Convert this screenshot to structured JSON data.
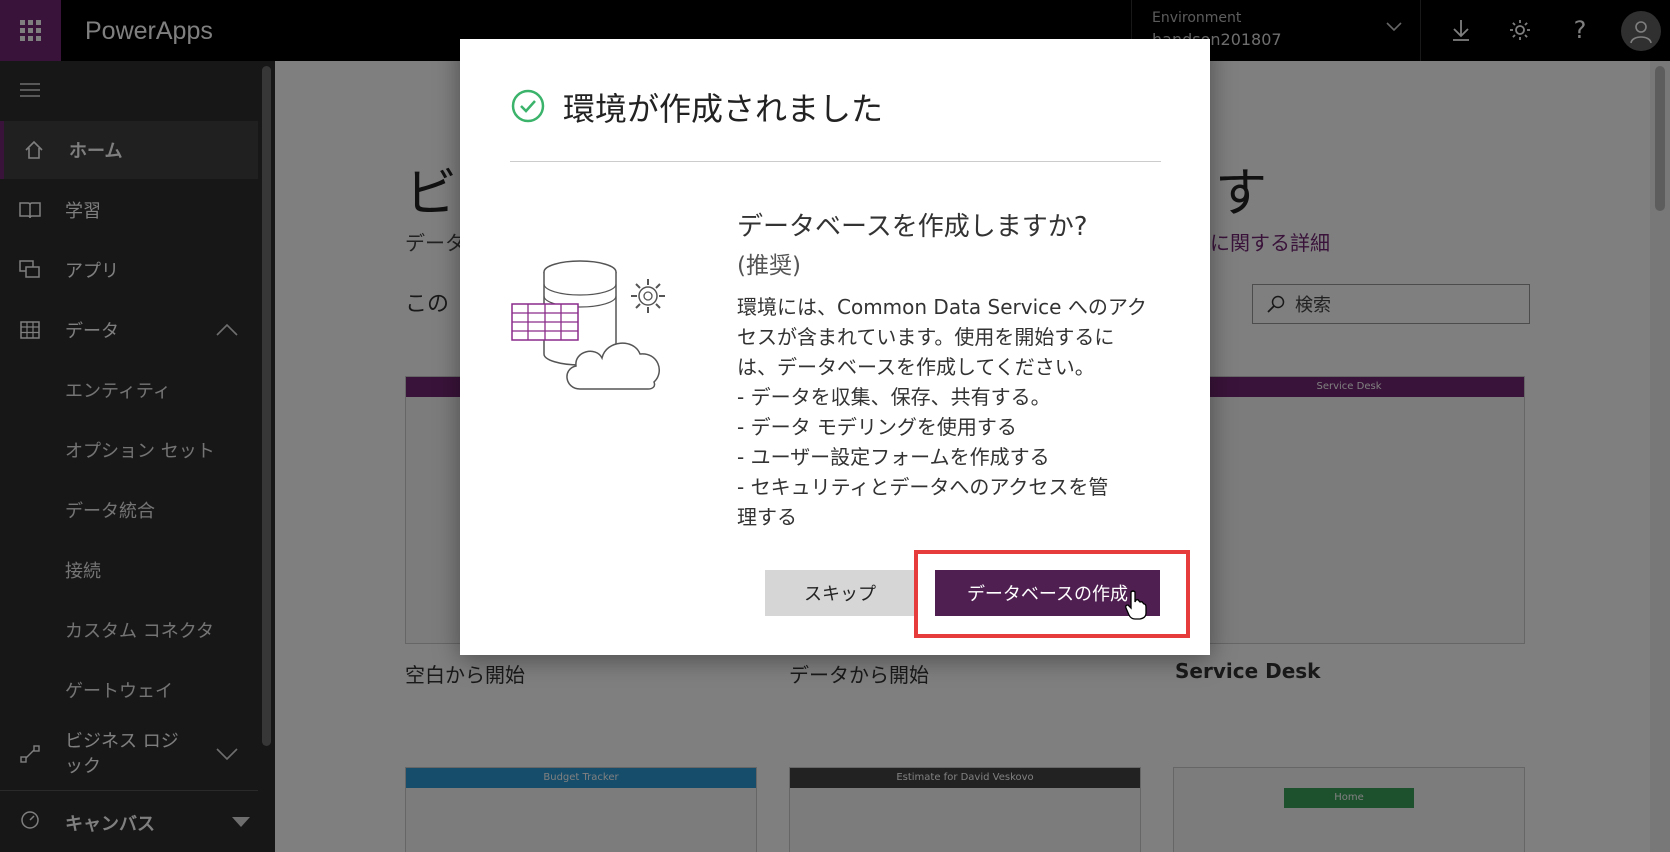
{
  "topbar": {
    "brand": "PowerApps",
    "environment_label": "Environment",
    "environment_name": "handson201807",
    "icons": [
      "waffle-icon",
      "download-icon",
      "gear-icon",
      "help-icon",
      "user-icon"
    ]
  },
  "sidebar": {
    "items": [
      {
        "label": "ホーム",
        "icon": "home-icon"
      },
      {
        "label": "学習",
        "icon": "book-icon"
      },
      {
        "label": "アプリ",
        "icon": "apps-icon"
      },
      {
        "label": "データ",
        "icon": "table-icon"
      },
      {
        "label": "エンティティ"
      },
      {
        "label": "オプション セット"
      },
      {
        "label": "データ統合"
      },
      {
        "label": "接続"
      },
      {
        "label": "カスタム コネクタ"
      },
      {
        "label": "ゲートウェイ"
      },
      {
        "label": "ビジネス ロジック",
        "line1": "ビジネス ロジ",
        "line2": "ック",
        "icon": "flow-icon"
      }
    ],
    "bottom": {
      "label": "キャンバス",
      "icon": "gauge-icon"
    }
  },
  "main": {
    "hero_title_start": "ビ",
    "hero_title_end": "す",
    "hero_sub": "データ",
    "hero_link": "に関する詳細",
    "section_title": "この",
    "search_placeholder": "検索",
    "cards": [
      {
        "label": "空白から開始"
      },
      {
        "label": "データから開始"
      },
      {
        "label": "Service Desk",
        "header": "Service Desk"
      },
      {
        "header": "Budget Tracker"
      },
      {
        "header": "Estimate for David Veskovo"
      },
      {
        "header": "Home"
      }
    ]
  },
  "dialog": {
    "title": "環境が作成されました",
    "question": "データベースを作成しますか?",
    "recommended": "(推奨)",
    "body_lines": [
      "環境には、Common Data Service へのアク",
      "セスが含まれています。使用を開始するに",
      "は、データベースを作成してください。",
      "- データを収集、保存、共有する。",
      "- データ モデリングを使用する",
      "- ユーザー設定フォームを作成する",
      "- セキュリティとデータへのアクセスを管",
      "理する"
    ],
    "skip_label": "スキップ",
    "create_label": "データベースの作成"
  },
  "colors": {
    "brand_purple": "#742774",
    "button_purple": "#4f1f52",
    "highlight_red": "#e63c3c",
    "success_green": "#3bb36b"
  }
}
